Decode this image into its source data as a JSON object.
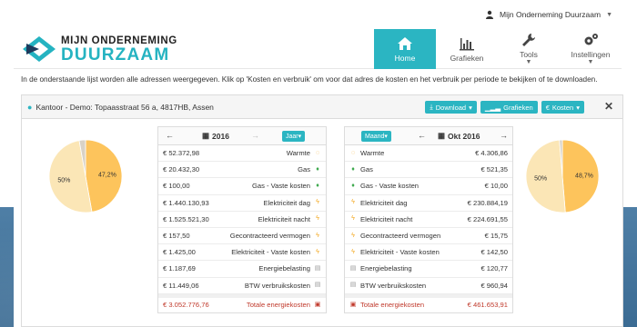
{
  "user": {
    "name": "Mijn Onderneming Duurzaam"
  },
  "logo": {
    "line1": "MIJN ONDERNEMING",
    "line2": "DUURZAAM"
  },
  "nav": [
    {
      "label": "Home",
      "icon": "home-icon",
      "active": true
    },
    {
      "label": "Grafieken",
      "icon": "bar-chart-icon",
      "active": false
    },
    {
      "label": "Tools",
      "icon": "wrench-icon",
      "active": false,
      "caret": true
    },
    {
      "label": "Instellingen",
      "icon": "gears-icon",
      "active": false,
      "caret": true
    }
  ],
  "intro": "In de onderstaande lijst worden alle adressen weergegeven. Klik op 'Kosten en verbruik' om voor dat adres de kosten en het verbruik per periode te bekijken of te downloaden.",
  "panel": {
    "location": "Kantoor - Demo: Topaasstraat 56 a, 4817HB, Assen",
    "buttons": {
      "download": "Download",
      "charts": "Grafieken",
      "costs": "Kosten"
    }
  },
  "left": {
    "period": "2016",
    "mode": "Jaar",
    "pie": {
      "values": [
        47.2,
        50,
        2.8
      ],
      "labels": [
        "47,2%",
        "50%"
      ]
    },
    "rows": [
      {
        "value": "€ 52.372,98",
        "label": "Warmte",
        "icon": "flame-icon"
      },
      {
        "value": "€ 20.432,30",
        "label": "Gas",
        "icon": "gas-icon"
      },
      {
        "value": "€ 100,00",
        "label": "Gas - Vaste kosten",
        "icon": "gas-icon"
      },
      {
        "value": "€ 1.440.130,93",
        "label": "Elektriciteit dag",
        "icon": "bolt-icon"
      },
      {
        "value": "€ 1.525.521,30",
        "label": "Elektriciteit nacht",
        "icon": "bolt-icon"
      },
      {
        "value": "€ 157,50",
        "label": "Gecontracteerd vermogen",
        "icon": "bolt-icon"
      },
      {
        "value": "€ 1.425,00",
        "label": "Elektriciteit - Vaste kosten",
        "icon": "bolt-icon"
      },
      {
        "value": "€ 1.187,69",
        "label": "Energiebelasting",
        "icon": "building-icon"
      },
      {
        "value": "€ 11.449,06",
        "label": "BTW verbruikskosten",
        "icon": "building-icon"
      }
    ],
    "total": {
      "value": "€ 3.052.776,76",
      "label": "Totale energiekosten"
    }
  },
  "right": {
    "period": "Okt 2016",
    "mode": "Maand",
    "pie": {
      "values": [
        48.7,
        50,
        1.3
      ],
      "labels": [
        "48,7%",
        "50%"
      ]
    },
    "rows": [
      {
        "value": "€ 4.306,86",
        "label": "Warmte",
        "icon": "flame-icon"
      },
      {
        "value": "€ 521,35",
        "label": "Gas",
        "icon": "gas-icon"
      },
      {
        "value": "€ 10,00",
        "label": "Gas - Vaste kosten",
        "icon": "gas-icon"
      },
      {
        "value": "€ 230.884,19",
        "label": "Elektriciteit dag",
        "icon": "bolt-icon"
      },
      {
        "value": "€ 224.691,55",
        "label": "Elektriciteit nacht",
        "icon": "bolt-icon"
      },
      {
        "value": "€ 15,75",
        "label": "Gecontracteerd vermogen",
        "icon": "bolt-icon"
      },
      {
        "value": "€ 142,50",
        "label": "Elektriciteit - Vaste kosten",
        "icon": "bolt-icon"
      },
      {
        "value": "€ 120,77",
        "label": "Energiebelasting",
        "icon": "building-icon"
      },
      {
        "value": "€ 960,94",
        "label": "BTW verbruikskosten",
        "icon": "building-icon"
      }
    ],
    "total": {
      "value": "€ 461.653,91",
      "label": "Totale energiekosten"
    }
  },
  "colors": {
    "accent": "#2bb5c2",
    "pie_main": "#fdc45c",
    "pie_light": "#fbe6b6",
    "pie_small": "#d9d2c6",
    "total_red": "#c0392b"
  }
}
